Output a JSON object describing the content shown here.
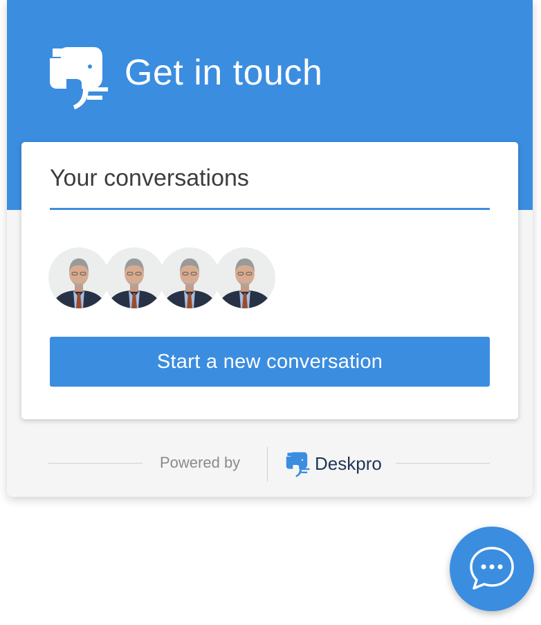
{
  "header": {
    "title": "Get in touch",
    "logo_icon": "deskpro-elephant-icon"
  },
  "card": {
    "title": "Your conversations",
    "avatars": [
      {
        "icon": "agent-avatar"
      },
      {
        "icon": "agent-avatar"
      },
      {
        "icon": "agent-avatar"
      },
      {
        "icon": "agent-avatar"
      }
    ],
    "start_button_label": "Start a new conversation"
  },
  "footer": {
    "powered_by": "Powered by",
    "brand_name": "Deskpro"
  },
  "chat_launcher": {
    "icon": "chat-bubble-icon"
  },
  "colors": {
    "accent": "#3b8de0",
    "panel_bg": "#f5f5f5",
    "brand_text": "#1f3554"
  }
}
